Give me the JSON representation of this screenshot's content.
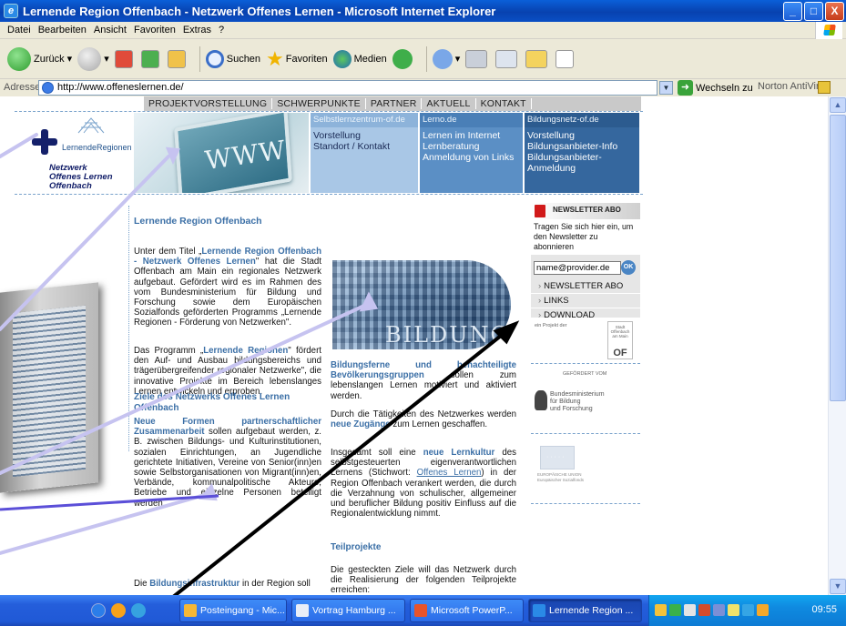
{
  "window": {
    "title": "Lernende Region Offenbach - Netzwerk Offenes Lernen - Microsoft Internet Explorer",
    "buttons": [
      "_",
      "□",
      "X"
    ]
  },
  "menu": [
    "Datei",
    "Bearbeiten",
    "Ansicht",
    "Favoriten",
    "Extras",
    "?"
  ],
  "toolbar": {
    "back": "Zurück",
    "search": "Suchen",
    "favorites": "Favoriten",
    "media": "Medien"
  },
  "address": {
    "label": "Adresse",
    "url": "http://www.offeneslernen.de/",
    "go": "Wechseln zu",
    "norton": "Norton AntiVirus"
  },
  "page": {
    "topnav": [
      "PROJEKTVORSTELLUNG",
      "SCHWERPUNKTE",
      "PARTNER",
      "AKTUELL",
      "KONTAKT"
    ],
    "logo": {
      "line1": "LernendeRegionen",
      "line2": "Netzwerk",
      "line3": "Offenes Lernen",
      "line4": "Offenbach"
    },
    "www": "WWW",
    "columns": [
      {
        "head": "Selbstlernzentrum-of.de",
        "items": [
          "Vorstellung",
          "Standort / Kontakt"
        ]
      },
      {
        "head": "Lerno.de",
        "items": [
          "Lernen im Internet",
          "Lernberatung",
          "Anmeldung von Links"
        ]
      },
      {
        "head": "Bildungsnetz-of.de",
        "items": [
          "Vorstellung",
          "Bildungsanbieter-Info",
          "Bildungsanbieter-",
          "Anmeldung"
        ]
      }
    ],
    "heading": "Lernende Region Offenbach",
    "p1_pre": "Unter dem Titel „",
    "p1_link": "Lernende Region Offenbach - Netzwerk Offenes Lernen",
    "p1_post": "\" hat die Stadt Offenbach am Main ein regionales Netzwerk aufgebaut. Gefördert wird es im Rahmen des vom Bundesministerium für Bildung und Forschung sowie dem Europäischen Sozialfonds geförderten Programms „Lernende Regionen - Förderung von Netzwerken\".",
    "p2_pre": "Das Programm „",
    "p2_link": "Lernende Regionen",
    "p2_post": "\" fördert den Auf- und Ausbau bildungsbereichs und trägerübergreifender regionaler Netzwerke\", die innovative Projekte im Bereich lebenslanges Lernen entwickeln und erproben.",
    "sub1": "Ziele des Netzwerks Offenes Lernen Offenbach",
    "p3_link": "Neue Formen partnerschaftlicher Zusammenarbeit",
    "p3_post": " sollen aufgebaut werden, z. B. zwischen Bildungs- und Kulturinstitutionen, sozialen Einrichtungen, an Jugendliche gerichtete Initiativen, Vereine von Senior(inn)en sowie Selbstorganisationen von Migrant(inn)en, Verbände, kommunalpolitische Akteure, Betriebe und einzelne Personen beteiligt werden.",
    "p4_pre": "Die ",
    "p4_link": "Bildungsinfrastruktur",
    "p4_post": " in der Region soll",
    "bildung_word": "BILDUNG",
    "r1_link": "Bildungsferne und benachteiligte Bevölkerungsgruppen",
    "r1_post": " sollen zum lebenslangen Lernen motiviert und aktiviert werden.",
    "r2_pre": "Durch die Tätigkeiten des Netzwerkes werden ",
    "r2_link": "neue Zugänge",
    "r2_post": " zum Lernen geschaffen.",
    "r3_pre": "Insgesamt soll eine ",
    "r3_link": "neue Lernkultur",
    "r3_mid": " des selbstgesteuerten eigenverantwortlichen Lernens (Stichwort: ",
    "r3_link2": "Offenes Lernen",
    "r3_post": ") in der Region Offenbach verankert werden, die durch die Verzahnung von schulischer, allgemeiner und beruflicher Bildung positiv Einfluss auf die Regionalentwicklung nimmt.",
    "sub2": "Teilprojekte",
    "r4": "Die gesteckten Ziele will das Netzwerk durch die Realisierung der folgenden Teilprojekte erreichen:",
    "newsletter": {
      "head": "NEWSLETTER ABO",
      "text": "Tragen Sie sich hier ein, um den Newsletter zu abonnieren",
      "input": "name@provider.de",
      "ok": "OK",
      "links": [
        "NEWSLETTER ABO",
        "LINKS",
        "DOWNLOAD"
      ]
    },
    "projekt_der": "ein Projekt der",
    "of_logo_small": "Stadt Offenbach am Main",
    "of_logo_big": "OF",
    "gefoerdert": "GEFÖRDERT VOM",
    "bmbf": [
      "Bundesministerium",
      "für Bildung",
      "und Forschung"
    ],
    "eu": [
      "EUROPÄISCHE UNION",
      "Europäischer Sozialfonds"
    ]
  },
  "taskbar": {
    "tasks": [
      "Posteingang - Mic...",
      "Vortrag Hamburg ...",
      "Microsoft PowerP...",
      "Lernende Region ..."
    ],
    "clock": "09:55"
  }
}
